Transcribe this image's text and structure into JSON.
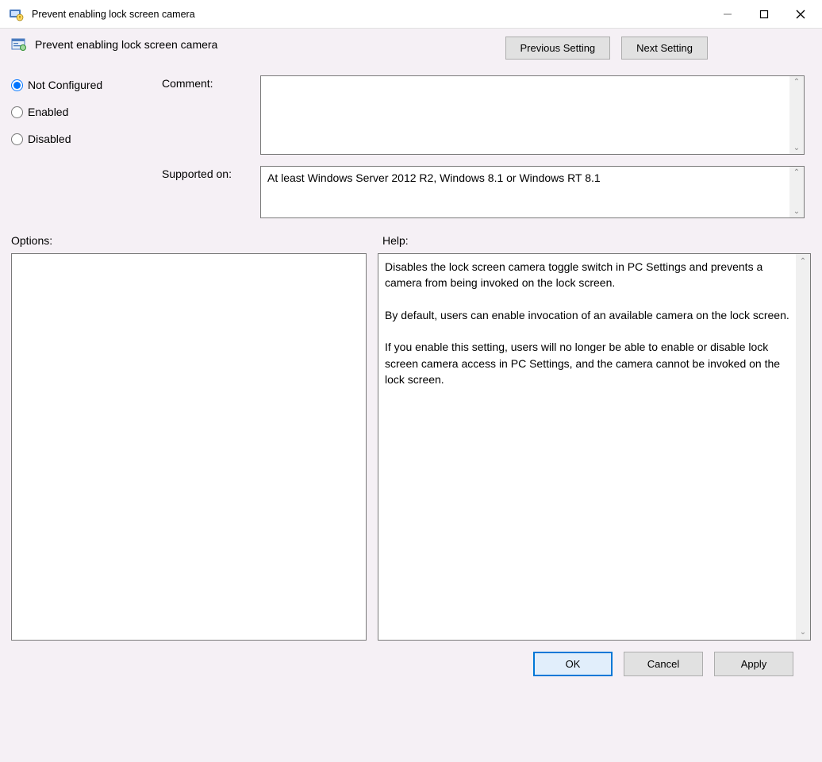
{
  "titlebar": {
    "title": "Prevent enabling lock screen camera"
  },
  "header": {
    "title": "Prevent enabling lock screen camera",
    "previous_label": "Previous Setting",
    "next_label": "Next Setting"
  },
  "config": {
    "radios": {
      "not_configured": "Not Configured",
      "enabled": "Enabled",
      "disabled": "Disabled",
      "selected": "not_configured"
    },
    "comment_label": "Comment:",
    "comment_value": "",
    "supported_label": "Supported on:",
    "supported_value": "At least Windows Server 2012 R2, Windows 8.1 or Windows RT 8.1"
  },
  "sections": {
    "options_label": "Options:",
    "help_label": "Help:"
  },
  "help": {
    "text": "Disables the lock screen camera toggle switch in PC Settings and prevents a camera from being invoked on the lock screen.\n\nBy default, users can enable invocation of an available camera on the lock screen.\n\nIf you enable this setting, users will no longer be able to enable or disable lock screen camera access in PC Settings, and the camera cannot be invoked on the lock screen."
  },
  "footer": {
    "ok": "OK",
    "cancel": "Cancel",
    "apply": "Apply"
  }
}
